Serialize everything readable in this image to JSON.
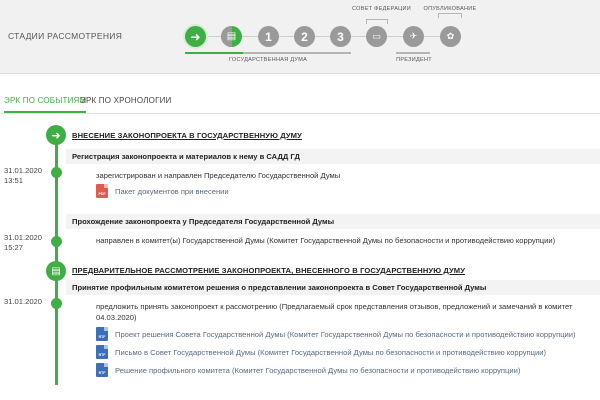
{
  "stages_bar": {
    "title": "СТАДИИ РАССМОТРЕНИЯ",
    "stages": [
      {
        "label": "➜",
        "state": "active"
      },
      {
        "label": "▤",
        "state": "half"
      },
      {
        "label": "1",
        "state": "pending"
      },
      {
        "label": "2",
        "state": "pending"
      },
      {
        "label": "3",
        "state": "pending"
      },
      {
        "label": "▭",
        "state": "pending"
      },
      {
        "label": "✈",
        "state": "pending"
      },
      {
        "label": "✿",
        "state": "pending"
      }
    ],
    "groups": {
      "duma": "ГОСУДАРСТВЕННАЯ ДУМА",
      "federation_council": "СОВЕТ ФЕДЕРАЦИИ",
      "president": "ПРЕЗИДЕНТ",
      "publication": "ОПУБЛИКОВАНИЕ"
    }
  },
  "tabs": {
    "by_events": "ЭРК ПО СОБЫТИЯМ",
    "by_chronology": "ЭРК ПО ХРОНОЛОГИИ"
  },
  "timeline": {
    "stage1": {
      "icon": "➜",
      "title": "ВНЕСЕНИЕ ЗАКОНОПРОЕКТА В ГОСУДАРСТВЕННУЮ ДУМУ",
      "event1": {
        "title": "Регистрация законопроекта и материалов к нему в САДД ГД",
        "date": "31.01.2020",
        "time": "13:51",
        "text": "зарегистрирован и направлен Председателю Государственной Думы",
        "doc_label": "Пакет документов при внесении",
        "doc_type": "PDF"
      },
      "event2": {
        "title": "Прохождение законопроекта у Председателя Государственной Думы",
        "date": "31.01.2020",
        "time": "15:27",
        "text": "направлен в комитет(ы) Государственной Думы (Комитет Государственной Думы по безопасности и противодействию коррупции)"
      }
    },
    "stage2": {
      "icon": "▤",
      "title": "ПРЕДВАРИТЕЛЬНОЕ РАССМОТРЕНИЕ ЗАКОНОПРОЕКТА, ВНЕСЕННОГО В ГОСУДАРСТВЕННУЮ ДУМУ",
      "event1": {
        "title": "Принятие профильным комитетом решения о представлении законопроекта в Совет Государственной Думы",
        "date": "31.01.2020",
        "text": "предложить принять законопроект к рассмотрению (Предлагаемый срок представления отзывов, предложений и замечаний в комитет 04.03.2020)",
        "doc_type": "RTF",
        "docs": [
          "Проект решения Совета Государственной Думы (Комитет Государственной Думы по безопасности и противодействию коррупции)",
          "Письмо в Совет Государственной Думы (Комитет Государственной Думы по безопасности и противодействию коррупции)",
          "Решение профильного комитета (Комитет Государственной Думы по безопасности и противодействию коррупции)"
        ]
      }
    }
  },
  "colors": {
    "accent": "#3fae45",
    "pending": "#9a9a9a",
    "pdf": "#e05a4f",
    "rtf": "#3b6fb6"
  }
}
